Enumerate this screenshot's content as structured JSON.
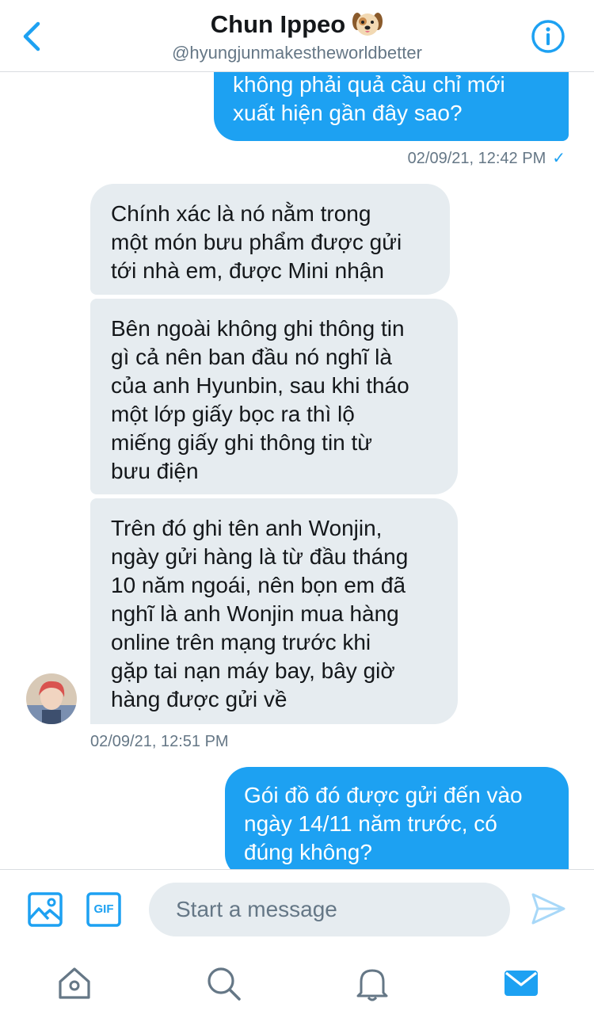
{
  "header": {
    "name": "Chun Ippeo",
    "handle": "@hyungjunmakestheworldbetter",
    "name_icon": "dog-emoji-icon",
    "back_icon": "chevron-left-icon",
    "info_icon": "info-icon"
  },
  "messages": [
    {
      "direction": "outgoing",
      "lines": [
        "không phải quả cầu chỉ mới",
        "xuất hiện gần đây sao?"
      ]
    },
    {
      "direction": "incoming",
      "lines": [
        "Chính xác là nó nằm trong",
        "một món bưu phẩm được gửi",
        "tới nhà em, được Mini nhận"
      ]
    },
    {
      "direction": "incoming",
      "lines": [
        "Bên ngoài không ghi thông tin",
        "gì cả nên ban đầu nó nghĩ là",
        "của anh Hyunbin, sau khi tháo",
        "một lớp giấy bọc ra thì lộ",
        "miếng giấy ghi thông tin từ",
        "bưu điện"
      ]
    },
    {
      "direction": "incoming",
      "lines": [
        "Trên đó ghi tên anh Wonjin,",
        "ngày gửi hàng là từ đầu tháng",
        "10 năm ngoái, nên bọn em đã",
        "nghĩ là anh Wonjin mua hàng",
        "online trên mạng trước khi",
        "gặp tai nạn máy bay, bây giờ",
        "hàng được gửi về"
      ]
    },
    {
      "direction": "outgoing",
      "lines": [
        "Gói đồ đó được gửi đến vào",
        "ngày 14/11 năm trước, có",
        "đúng không?"
      ]
    }
  ],
  "timestamps": {
    "outgoing_first": "02/09/21, 12:42 PM",
    "incoming_group": "02/09/21, 12:51 PM"
  },
  "composer": {
    "placeholder": "Start a message",
    "image_icon": "image-icon",
    "gif_label": "GIF",
    "send_icon": "send-icon"
  },
  "tabbar": {
    "items": [
      "home-icon",
      "search-icon",
      "notifications-bell-icon",
      "messages-envelope-icon"
    ]
  },
  "colors": {
    "accent": "#1da1f2",
    "incoming_bubble": "#e6ecf0",
    "secondary_text": "#657786"
  }
}
